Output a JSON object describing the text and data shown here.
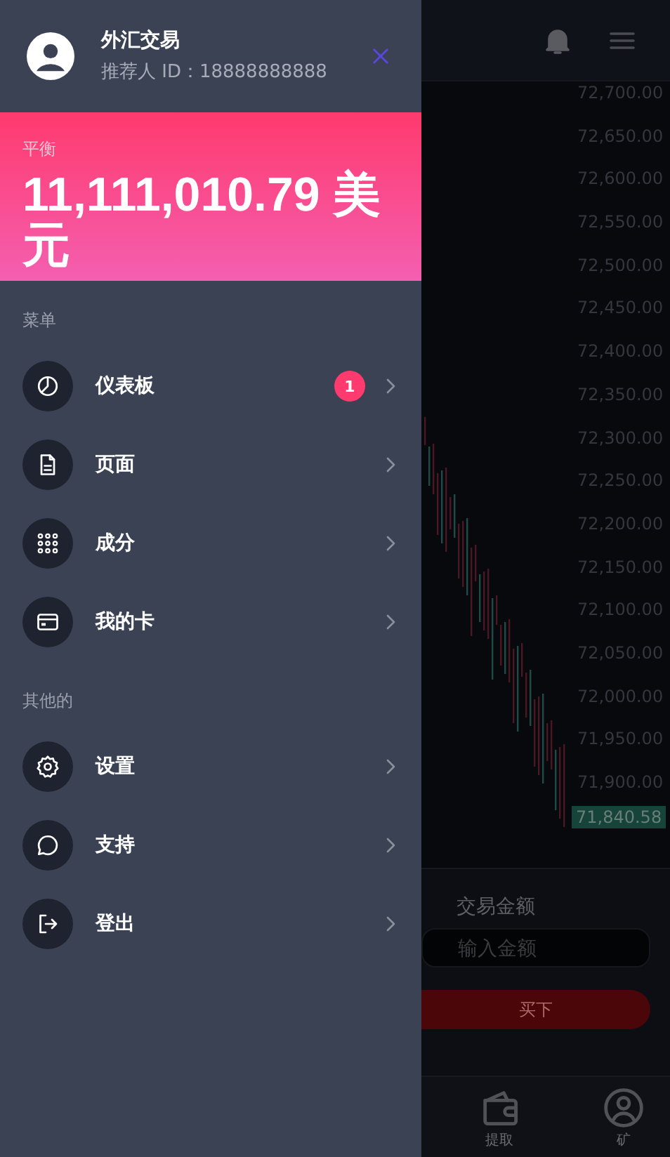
{
  "app": {
    "price_axis": [
      "72,700.00",
      "72,650.00",
      "72,600.00",
      "72,550.00",
      "72,500.00",
      "72,450.00",
      "72,400.00",
      "72,350.00",
      "72,300.00",
      "72,250.00",
      "72,200.00",
      "72,150.00",
      "72,100.00",
      "72,050.00",
      "72,000.00",
      "71,950.00",
      "71,900.00"
    ],
    "current_price": "71,840.58",
    "trade_panel": {
      "label": "交易金额",
      "amount_field": {
        "placeholder": "输入金额"
      },
      "buy_button": "买下"
    },
    "bottom_nav": [
      {
        "label": "提取"
      },
      {
        "label": "矿"
      }
    ]
  },
  "drawer": {
    "user": {
      "name": "外汇交易",
      "referrer_id": "推荐人 ID：18888888888"
    },
    "balance": {
      "label": "平衡",
      "amount": "11,111,010.79 美元"
    },
    "sections": [
      {
        "title": "菜单",
        "items": [
          {
            "label": "仪表板",
            "badge": "1"
          },
          {
            "label": "页面"
          },
          {
            "label": "成分"
          },
          {
            "label": "我的卡"
          }
        ]
      },
      {
        "title": "其他的",
        "items": [
          {
            "label": "设置"
          },
          {
            "label": "支持"
          },
          {
            "label": "登出"
          }
        ]
      }
    ]
  }
}
